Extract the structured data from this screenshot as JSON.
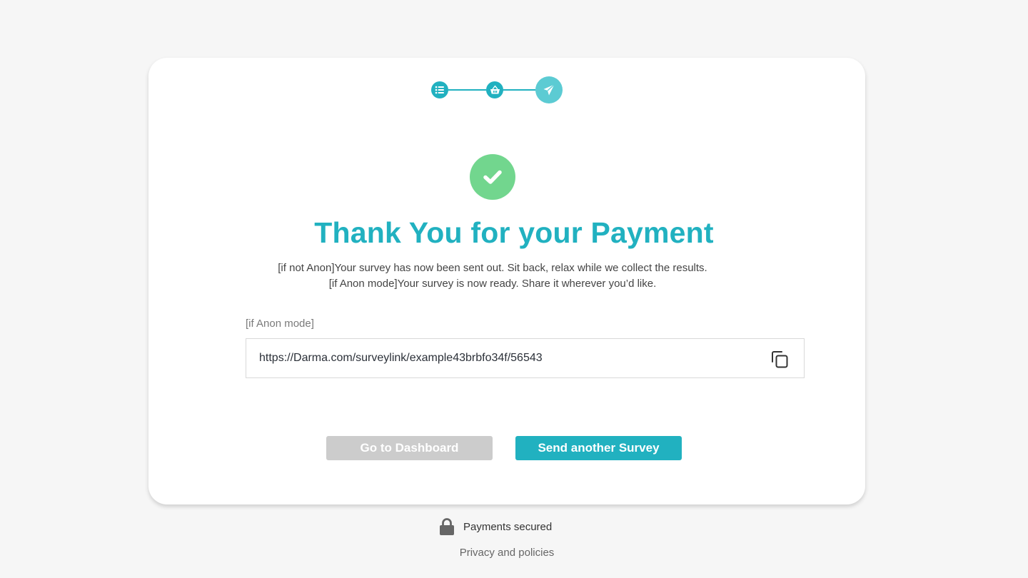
{
  "stepper": {
    "steps": [
      {
        "icon": "list-icon",
        "state": "complete"
      },
      {
        "icon": "basket-icon",
        "state": "complete"
      },
      {
        "icon": "send-icon",
        "state": "active"
      }
    ]
  },
  "success_icon": "check-circle-icon",
  "title": "Thank You for your Payment",
  "messages": {
    "line1": "[if not Anon]Your survey has now been sent out. Sit back, relax while we collect the results.",
    "line2": "[if Anon mode]Your survey is now ready. Share it wherever you’d like."
  },
  "link_field": {
    "label": "[if Anon mode]",
    "value": "https://Darma.com/surveylink/example43brbfo34f/56543",
    "copy_icon": "copy-icon"
  },
  "buttons": {
    "dashboard": "Go to Dashboard",
    "send_another": "Send another Survey"
  },
  "footer": {
    "secure_text": "Payments secured",
    "privacy": "Privacy and policies"
  },
  "colors": {
    "accent": "#21b1c0",
    "accent_light": "#5ccbd3",
    "success": "#72d68e",
    "disabled": "#cccccc",
    "background": "#f6f6f6"
  }
}
